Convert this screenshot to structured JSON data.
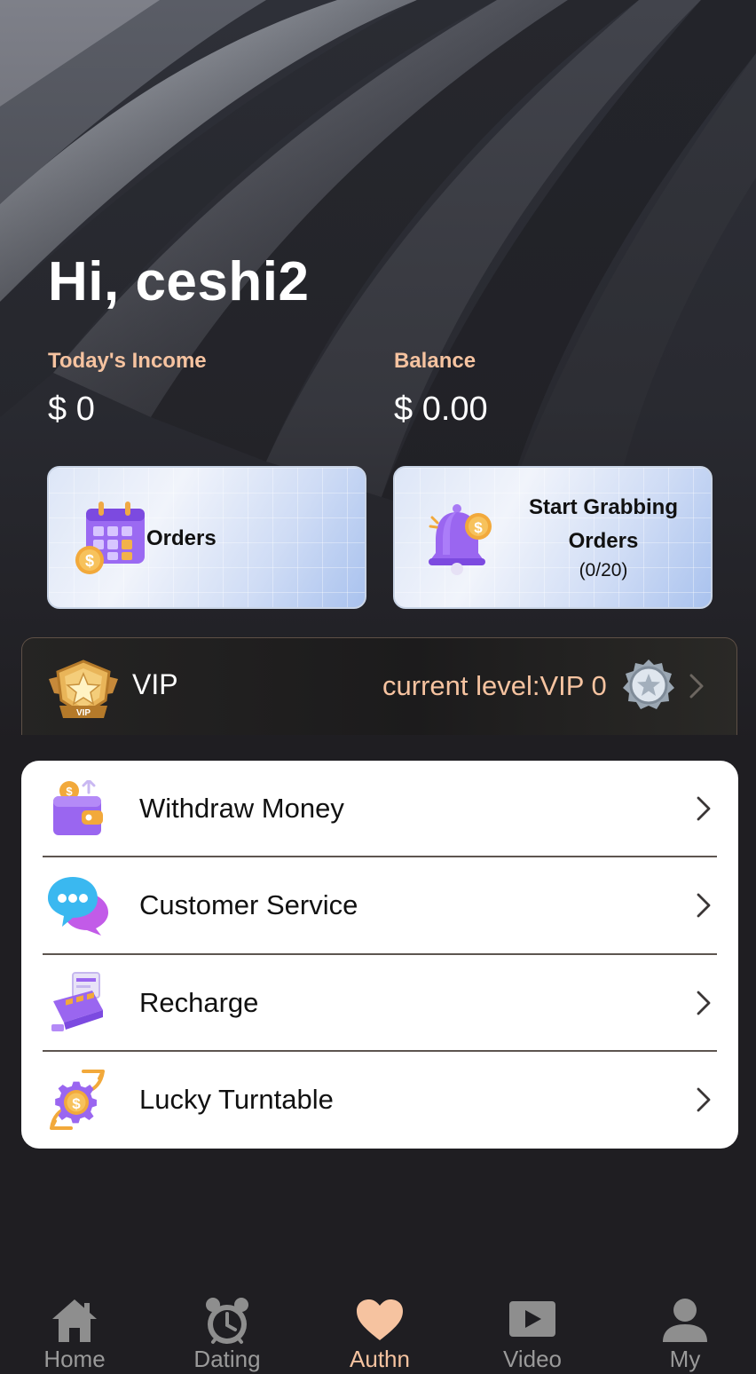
{
  "header": {
    "greeting": "Hi, ceshi2",
    "income_label": "Today's Income",
    "income_value": "$ 0",
    "balance_label": "Balance",
    "balance_value": "$ 0.00"
  },
  "cards": {
    "orders_label": "Orders",
    "grab_title": "Start Grabbing Orders",
    "grab_count": "(0/20)"
  },
  "vip": {
    "badge_text": "VIP",
    "title": "VIP",
    "level_text": "current level:VIP 0"
  },
  "menu": {
    "items": [
      {
        "label": "Withdraw Money",
        "icon": "wallet-icon"
      },
      {
        "label": "Customer Service",
        "icon": "chat-bubbles-icon"
      },
      {
        "label": "Recharge",
        "icon": "pos-terminal-icon"
      },
      {
        "label": "Lucky Turntable",
        "icon": "coin-gear-icon"
      }
    ]
  },
  "nav": {
    "active": "Authn",
    "items": [
      {
        "label": "Home",
        "icon": "home-icon"
      },
      {
        "label": "Dating",
        "icon": "alarm-clock-icon"
      },
      {
        "label": "Authn",
        "icon": "heart-icon"
      },
      {
        "label": "Video",
        "icon": "video-camera-icon"
      },
      {
        "label": "My",
        "icon": "user-icon"
      }
    ]
  },
  "colors": {
    "accent": "#f6c3a0",
    "background": "#1f1e22",
    "menu_bg": "#ffffff",
    "icon_purple": "#8c5cf0",
    "coin_gold": "#f2a93b",
    "nav_inactive": "#9a9a9a"
  }
}
